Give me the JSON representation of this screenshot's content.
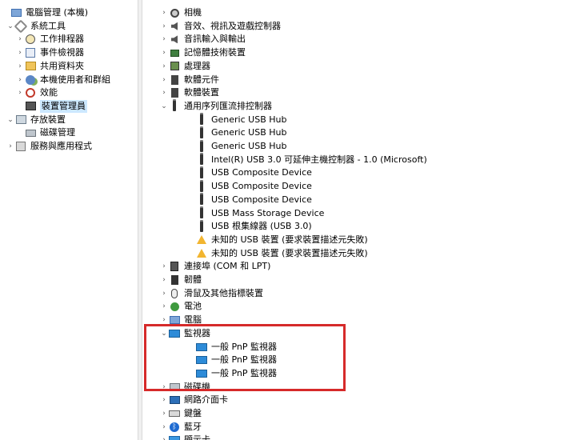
{
  "left_tree": [
    {
      "label": "電腦管理 (本機)",
      "icon": "computer-icon",
      "indent": 0,
      "arrow": ""
    },
    {
      "label": "系統工具",
      "icon": "tools-icon",
      "indent": 1,
      "arrow": "v"
    },
    {
      "label": "工作排程器",
      "icon": "clock-icon",
      "indent": 2,
      "arrow": ">"
    },
    {
      "label": "事件檢視器",
      "icon": "event-viewer-icon",
      "indent": 2,
      "arrow": ">"
    },
    {
      "label": "共用資料夾",
      "icon": "shared-folder-icon",
      "indent": 2,
      "arrow": ">"
    },
    {
      "label": "本機使用者和群組",
      "icon": "users-icon",
      "indent": 2,
      "arrow": ">"
    },
    {
      "label": "效能",
      "icon": "performance-icon",
      "indent": 2,
      "arrow": ">"
    },
    {
      "label": "裝置管理員",
      "icon": "device-manager-icon",
      "indent": 2,
      "arrow": "",
      "selected": true
    },
    {
      "label": "存放裝置",
      "icon": "storage-icon",
      "indent": 1,
      "arrow": "v"
    },
    {
      "label": "磁碟管理",
      "icon": "disk-icon",
      "indent": 2,
      "arrow": ""
    },
    {
      "label": "服務與應用程式",
      "icon": "services-icon",
      "indent": 1,
      "arrow": ">"
    }
  ],
  "device_tree": [
    {
      "label": "相機",
      "icon": "camera-icon",
      "level": 0,
      "arrow": ">"
    },
    {
      "label": "音效、視訊及遊戲控制器",
      "icon": "audio-icon",
      "level": 0,
      "arrow": ">"
    },
    {
      "label": "音訊輸入與輸出",
      "icon": "audio-io-icon",
      "level": 0,
      "arrow": ">"
    },
    {
      "label": "記憶體技術裝置",
      "icon": "memory-icon",
      "level": 0,
      "arrow": ">"
    },
    {
      "label": "處理器",
      "icon": "processor-icon",
      "level": 0,
      "arrow": ">"
    },
    {
      "label": "軟體元件",
      "icon": "software-component-icon",
      "level": 0,
      "arrow": ">"
    },
    {
      "label": "軟體裝置",
      "icon": "software-device-icon",
      "level": 0,
      "arrow": ">"
    },
    {
      "label": "通用序列匯流排控制器",
      "icon": "usb-icon",
      "level": 0,
      "arrow": "v"
    },
    {
      "label": "Generic USB Hub",
      "icon": "usb-icon",
      "level": 1,
      "arrow": ""
    },
    {
      "label": "Generic USB Hub",
      "icon": "usb-icon",
      "level": 1,
      "arrow": ""
    },
    {
      "label": "Generic USB Hub",
      "icon": "usb-icon",
      "level": 1,
      "arrow": ""
    },
    {
      "label": "Intel(R) USB 3.0 可延伸主機控制器 - 1.0 (Microsoft)",
      "icon": "usb-icon",
      "level": 1,
      "arrow": ""
    },
    {
      "label": "USB Composite Device",
      "icon": "usb-icon",
      "level": 1,
      "arrow": ""
    },
    {
      "label": "USB Composite Device",
      "icon": "usb-icon",
      "level": 1,
      "arrow": ""
    },
    {
      "label": "USB Composite Device",
      "icon": "usb-icon",
      "level": 1,
      "arrow": ""
    },
    {
      "label": "USB Mass Storage Device",
      "icon": "usb-icon",
      "level": 1,
      "arrow": ""
    },
    {
      "label": "USB 根集線器 (USB 3.0)",
      "icon": "usb-icon",
      "level": 1,
      "arrow": ""
    },
    {
      "label": "未知的 USB 裝置 (要求裝置描述元失敗)",
      "icon": "warning-icon",
      "level": 1,
      "arrow": ""
    },
    {
      "label": "未知的 USB 裝置 (要求裝置描述元失敗)",
      "icon": "warning-icon",
      "level": 1,
      "arrow": ""
    },
    {
      "label": "連接埠 (COM 和 LPT)",
      "icon": "port-icon",
      "level": 0,
      "arrow": ">"
    },
    {
      "label": "韌體",
      "icon": "firmware-icon",
      "level": 0,
      "arrow": ">"
    },
    {
      "label": "滑鼠及其他指標裝置",
      "icon": "mouse-icon",
      "level": 0,
      "arrow": ">"
    },
    {
      "label": "電池",
      "icon": "battery-icon",
      "level": 0,
      "arrow": ">"
    },
    {
      "label": "電腦",
      "icon": "computer-icon",
      "level": 0,
      "arrow": ">"
    },
    {
      "label": "監視器",
      "icon": "monitor-icon",
      "level": 0,
      "arrow": "v"
    },
    {
      "label": "一般 PnP 監視器",
      "icon": "monitor-icon",
      "level": 1,
      "arrow": ""
    },
    {
      "label": "一般 PnP 監視器",
      "icon": "monitor-icon",
      "level": 1,
      "arrow": ""
    },
    {
      "label": "一般 PnP 監視器",
      "icon": "monitor-icon",
      "level": 1,
      "arrow": ""
    },
    {
      "label": "磁碟機",
      "icon": "disk-drive-icon",
      "level": 0,
      "arrow": ">"
    },
    {
      "label": "網路介面卡",
      "icon": "network-adapter-icon",
      "level": 0,
      "arrow": ">"
    },
    {
      "label": "鍵盤",
      "icon": "keyboard-icon",
      "level": 0,
      "arrow": ">"
    },
    {
      "label": "藍牙",
      "icon": "bluetooth-icon",
      "level": 0,
      "arrow": ">"
    },
    {
      "label": "顯示卡",
      "icon": "display-adapter-icon",
      "level": 0,
      "arrow": ">"
    }
  ],
  "colors": {
    "highlight_box": "#d62a2a",
    "selection": "#cce8ff"
  }
}
